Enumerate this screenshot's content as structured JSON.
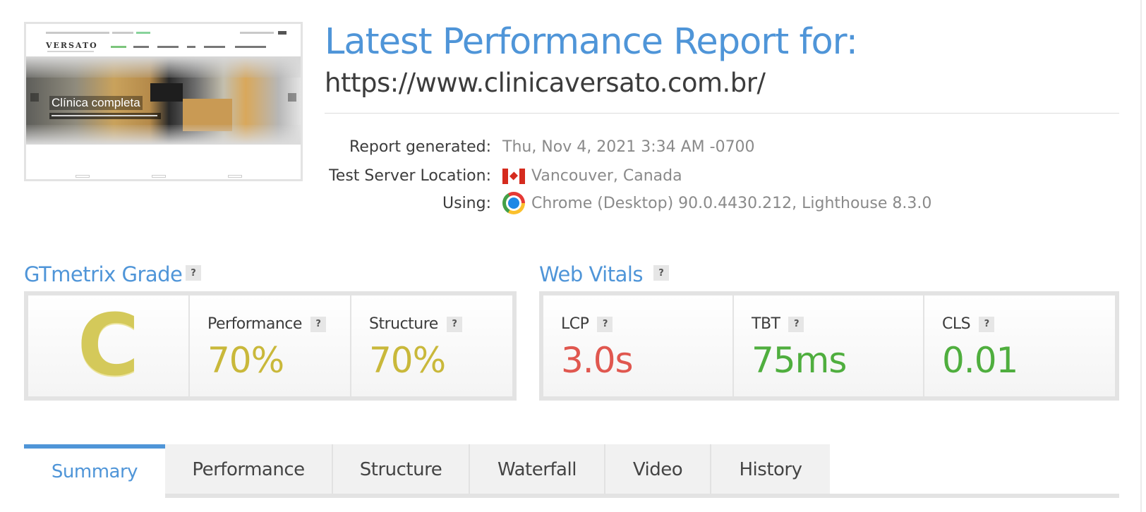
{
  "screenshot": {
    "logo_text": "VERSATO",
    "caption": "Clínica completa"
  },
  "header": {
    "title": "Latest Performance Report for:",
    "url": "https://www.clinicaversato.com.br/"
  },
  "meta": {
    "generated_label": "Report generated:",
    "generated_value": "Thu, Nov 4, 2021 3:34 AM -0700",
    "location_label": "Test Server Location:",
    "location_icon": "canada-flag-icon",
    "location_value": "Vancouver, Canada",
    "using_label": "Using:",
    "using_icon": "chrome-icon",
    "using_value": "Chrome (Desktop) 90.0.4430.212, Lighthouse 8.3.0"
  },
  "grade": {
    "title": "GTmetrix Grade",
    "help": "?",
    "letter": "C",
    "performance_label": "Performance",
    "performance_value": "70%",
    "structure_label": "Structure",
    "structure_value": "70%",
    "grade_color": "#d4c95a",
    "value_color": "#c9b83a"
  },
  "vitals": {
    "title": "Web Vitals",
    "help": "?",
    "lcp_label": "LCP",
    "lcp_value": "3.0s",
    "lcp_color": "#e0574f",
    "tbt_label": "TBT",
    "tbt_value": "75ms",
    "tbt_color": "#4fae3e",
    "cls_label": "CLS",
    "cls_value": "0.01",
    "cls_color": "#4fae3e"
  },
  "tabs": [
    "Summary",
    "Performance",
    "Structure",
    "Waterfall",
    "Video",
    "History"
  ],
  "active_tab": "Summary",
  "accent_color": "#4f95d8"
}
